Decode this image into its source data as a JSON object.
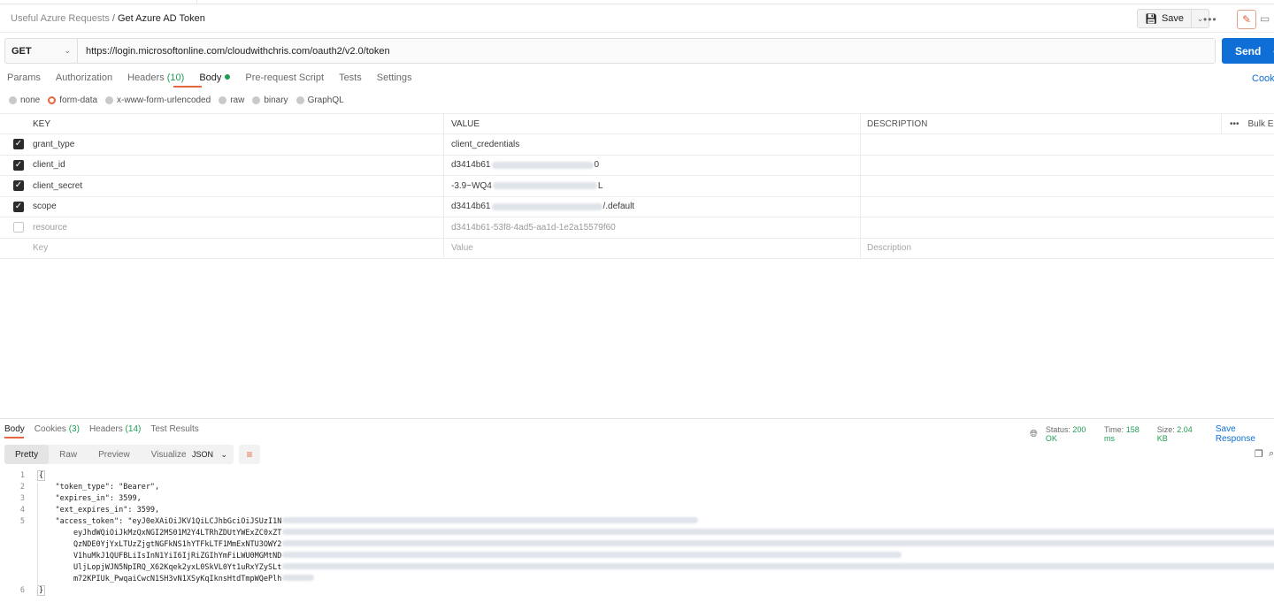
{
  "header": {
    "breadcrumb_parent": "Useful Azure Requests",
    "breadcrumb_sep": "/",
    "breadcrumb_current": "Get Azure AD Token",
    "save_label": "Save",
    "more_label": "•••"
  },
  "request": {
    "method": "GET",
    "url": "https://login.microsoftonline.com/cloudwithchris.com/oauth2/v2.0/token",
    "send_label": "Send"
  },
  "tabs": {
    "params": "Params",
    "authorization": "Authorization",
    "headers": "Headers",
    "headers_count": "(10)",
    "body": "Body",
    "prerequest": "Pre-request Script",
    "tests": "Tests",
    "settings": "Settings",
    "cookies": "Cooki"
  },
  "body_types": {
    "none": "none",
    "form_data": "form-data",
    "urlencoded": "x-www-form-urlencoded",
    "raw": "raw",
    "binary": "binary",
    "graphql": "GraphQL"
  },
  "table": {
    "col_key": "KEY",
    "col_value": "VALUE",
    "col_description": "DESCRIPTION",
    "bulk_edit": "Bulk E",
    "rows": [
      {
        "key": "grant_type",
        "value_start": "client_credentials",
        "value_end": ""
      },
      {
        "key": "client_id",
        "value_start": "d3414b61",
        "value_end": "0"
      },
      {
        "key": "client_secret",
        "value_start": "-3.9~WQ4",
        "value_end": "L"
      },
      {
        "key": "scope",
        "value_start": "d3414b61",
        "value_end": "/.default"
      },
      {
        "key": "resource",
        "value_start": "d3414b61-53f8-4ad5-aa1d-1e2a15579f60",
        "value_end": ""
      }
    ],
    "placeholder_key": "Key",
    "placeholder_value": "Value",
    "placeholder_description": "Description"
  },
  "response": {
    "tab_body": "Body",
    "tab_cookies": "Cookies",
    "cookies_count": "(3)",
    "tab_headers": "Headers",
    "headers_count": "(14)",
    "tab_tests": "Test Results",
    "status_label": "Status:",
    "status_value": "200 OK",
    "time_label": "Time:",
    "time_value": "158 ms",
    "size_label": "Size:",
    "size_value": "2.04 KB",
    "save_response": "Save Response",
    "view_pretty": "Pretty",
    "view_raw": "Raw",
    "view_preview": "Preview",
    "view_visualize": "Visualize",
    "format": "JSON",
    "lines": [
      {
        "n": "1",
        "text": "{"
      },
      {
        "n": "2",
        "text": "    \"token_type\": \"Bearer\","
      },
      {
        "n": "3",
        "text": "    \"expires_in\": 3599,"
      },
      {
        "n": "4",
        "text": "    \"ext_expires_in\": 3599,"
      },
      {
        "n": "5",
        "text": "    \"access_token\": \"eyJ0eXAiOiJKV1QiLCJhbGciOiJSUzI1N"
      },
      {
        "n": "",
        "text": "        eyJhdWQiOiJkMzQxNGI2MS01M2Y4LTRhZDUtYWExZC0xZT"
      },
      {
        "n": "",
        "text": "        QzNDE0YjYxLTUzZjgtNGFkNS1hYTFkLTF1MmExNTU3OWY2"
      },
      {
        "n": "",
        "text": "        V1huMkJ1QUFBLiIsInN1YiI6IjRiZGIhYmFiLWU0MGMtND"
      },
      {
        "n": "",
        "text": "        UljLopjWJN5NpIRQ_X62Kqek2yxL0SkVL0Yt1uRxYZySLt"
      },
      {
        "n": "",
        "text": "        m72KPIUk_PwqaiCwcN1SH3vN1XSyKqIknsHtdTmpWQePlh"
      },
      {
        "n": "6",
        "text": "}"
      }
    ]
  }
}
